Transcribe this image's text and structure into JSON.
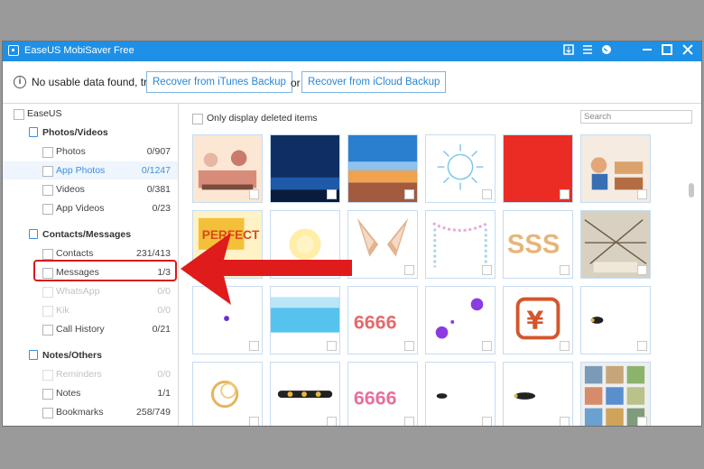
{
  "window": {
    "title": "EaseUS MobiSaver Free"
  },
  "titlebar_icons": [
    "feedback-icon",
    "menu-icon",
    "globe-icon",
    "minimize-icon",
    "maximize-icon",
    "close-icon"
  ],
  "infobar": {
    "message": "No usable data found, try",
    "itunes_button": "Recover from iTunes Backup",
    "or_text": "or",
    "icloud_button": "Recover from iCloud Backup"
  },
  "sidebar": {
    "root": "EaseUS",
    "groups": [
      {
        "label": "Photos/Videos",
        "icon": "photo-icon",
        "items": [
          {
            "label": "Photos",
            "count": "0/907",
            "state": "normal"
          },
          {
            "label": "App Photos",
            "count": "0/1247",
            "state": "selected"
          },
          {
            "label": "Videos",
            "count": "0/381",
            "state": "normal"
          },
          {
            "label": "App Videos",
            "count": "0/23",
            "state": "normal"
          }
        ]
      },
      {
        "label": "Contacts/Messages",
        "icon": "contacts-icon",
        "items": [
          {
            "label": "Contacts",
            "count": "231/413",
            "state": "normal"
          },
          {
            "label": "Messages",
            "count": "1/3",
            "state": "highlighted"
          },
          {
            "label": "WhatsApp",
            "count": "0/0",
            "state": "disabled"
          },
          {
            "label": "Kik",
            "count": "0/0",
            "state": "disabled"
          },
          {
            "label": "Call History",
            "count": "0/21",
            "state": "normal"
          }
        ]
      },
      {
        "label": "Notes/Others",
        "icon": "notes-icon",
        "items": [
          {
            "label": "Reminders",
            "count": "0/0",
            "state": "disabled"
          },
          {
            "label": "Notes",
            "count": "1/1",
            "state": "normal"
          },
          {
            "label": "Bookmarks",
            "count": "258/749",
            "state": "normal"
          }
        ]
      }
    ]
  },
  "main": {
    "deleted_only_label": "Only display deleted items",
    "search_placeholder": "Search",
    "thumbnails": [
      "cartoon-scene",
      "night-sky",
      "sunset-sea",
      "line-illustration",
      "red-image",
      "cartoon-people",
      "yellow-banner",
      "glow",
      "fox-ears",
      "beads-frame",
      "sss-text",
      "sketch-collage",
      "dot",
      "blue-gradient",
      "66666-text",
      "purple-balls",
      "yuan-icon",
      "bee",
      "golden-rings",
      "bees-row",
      "66666-pink",
      "bee-small",
      "bee-trail",
      "photo-collage"
    ]
  },
  "annotation": {
    "arrow_color": "#e01b1b",
    "highlight_color": "#d7191b"
  },
  "colors": {
    "titlebar": "#1e90e6",
    "accent": "#3d8fe0"
  }
}
